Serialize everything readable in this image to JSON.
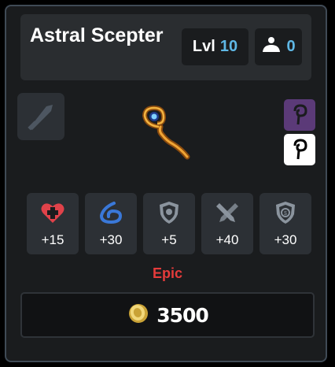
{
  "item": {
    "name": "Astral Scepter",
    "level_label": "Lvl",
    "level_value": "10",
    "weight_value": "0",
    "rarity": "Epic",
    "price": "3500"
  },
  "stats": [
    {
      "icon": "heart-plus-icon",
      "value": "+15"
    },
    {
      "icon": "water-swirl-icon",
      "value": "+30"
    },
    {
      "icon": "shield-icon",
      "value": "+5"
    },
    {
      "icon": "crossed-swords-icon",
      "value": "+40"
    },
    {
      "icon": "shield-coin-icon",
      "value": "+30"
    }
  ],
  "colors": {
    "accent": "#5fb8e6",
    "rarity": "#e53b3b",
    "rarity_badge": "#5b3a78"
  }
}
